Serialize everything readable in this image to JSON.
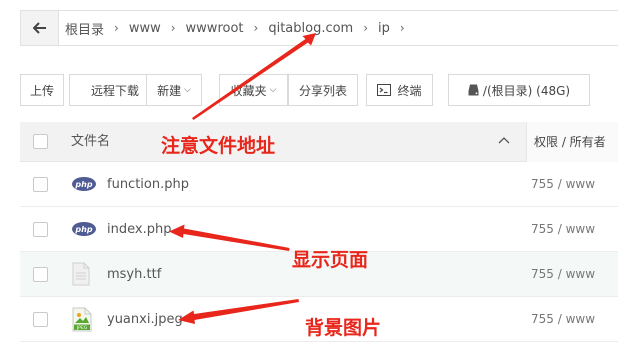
{
  "breadcrumb": {
    "items": [
      "根目录",
      "www",
      "wwwroot",
      "qitablog.com",
      "ip"
    ],
    "separator": "›"
  },
  "toolbar": {
    "upload": "上传",
    "remote_download": "远程下载",
    "new": "新建",
    "favorites": "收藏夹",
    "share_list": "分享列表",
    "terminal": "终端",
    "disk": "/(根目录) (48G)"
  },
  "table": {
    "col_name": "文件名",
    "col_perm": "权限 / 所有者",
    "rows": [
      {
        "name": "function.php",
        "perm": "755 / www",
        "icon": "php-file-icon"
      },
      {
        "name": "index.php",
        "perm": "755 / www",
        "icon": "php-file-icon"
      },
      {
        "name": "msyh.ttf",
        "perm": "755 / www",
        "icon": "generic-file-icon"
      },
      {
        "name": "yuanxi.jpeg",
        "perm": "755 / www",
        "icon": "jpeg-file-icon"
      }
    ]
  },
  "icons": {
    "php_label": "php",
    "jpeg_label": "JPEG"
  },
  "annotations": {
    "note_address": "注意文件地址",
    "note_display": "显示页面",
    "note_background": "背景图片",
    "color": "#e8261b"
  }
}
